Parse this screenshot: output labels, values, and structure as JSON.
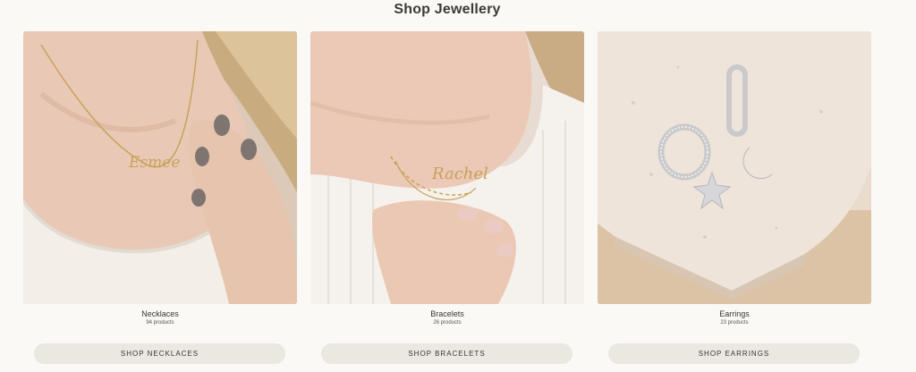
{
  "section": {
    "title": "Shop Jewellery"
  },
  "collections": [
    {
      "name": "Necklaces",
      "count": "94 products",
      "button": "SHOP NECKLACES",
      "image": "woman-wearing-gold-name-necklace",
      "necklace_text": "Esmee"
    },
    {
      "name": "Bracelets",
      "count": "26 products",
      "button": "SHOP BRACELETS",
      "image": "wrist-with-gold-name-bracelet",
      "bracelet_text": "Rachel"
    },
    {
      "name": "Earrings",
      "count": "23 products",
      "button": "SHOP EARRINGS",
      "image": "silver-hoop-earrings-on-stone"
    }
  ],
  "colors": {
    "background": "#faf9f6",
    "button_bg": "#ebe7e1",
    "text": "#3a3532",
    "gold": "#c9a15a",
    "silver": "#c9c9cc"
  }
}
